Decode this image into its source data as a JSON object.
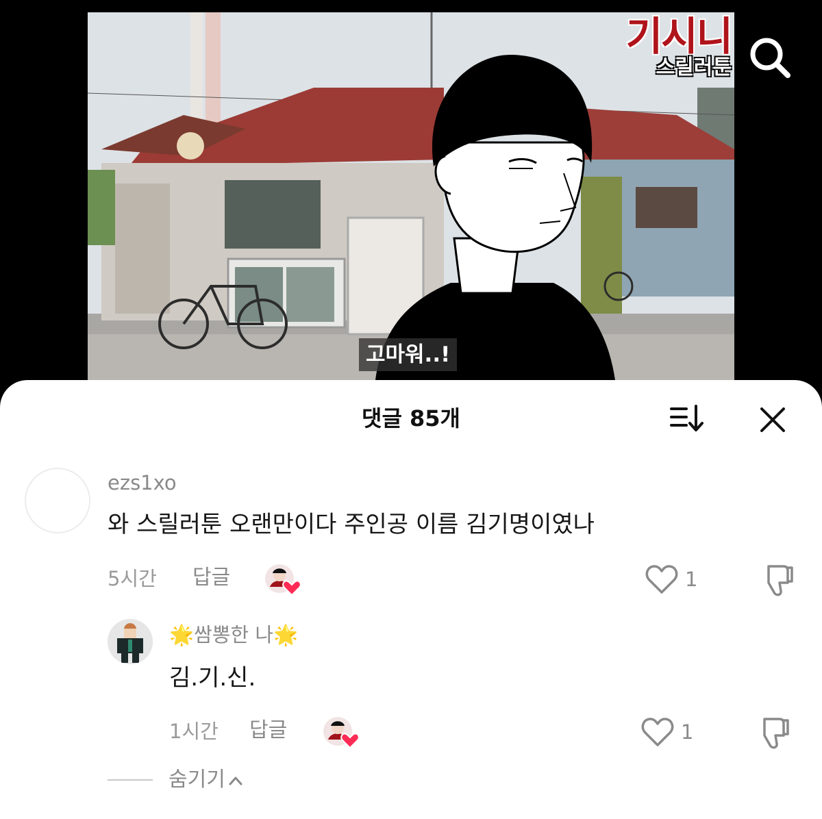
{
  "video": {
    "channel_logo_main": "기시니",
    "channel_logo_sub": "스릴러툰",
    "subtitle": "고마워..!"
  },
  "header": {
    "search_icon": "search-icon"
  },
  "comments_panel": {
    "title": "댓글 85개",
    "sort_icon": "sort-icon",
    "close_icon": "close-icon",
    "comments": [
      {
        "username": "ezs1xo",
        "text": "와 스릴러툰 오랜만이다 주인공 이름 김기명이였나",
        "time": "5시간",
        "reply_label": "답글",
        "like_count": "1",
        "replies": [
          {
            "username": "🌟쌈뽕한 나🌟",
            "text": "김.기.신.",
            "time": "1시간",
            "reply_label": "답글",
            "like_count": "1"
          }
        ]
      }
    ],
    "hide_replies_label": "숨기기"
  },
  "colors": {
    "creator_heart": "#fe2c55",
    "text_primary": "#161616",
    "text_secondary": "#8a8a8a"
  }
}
